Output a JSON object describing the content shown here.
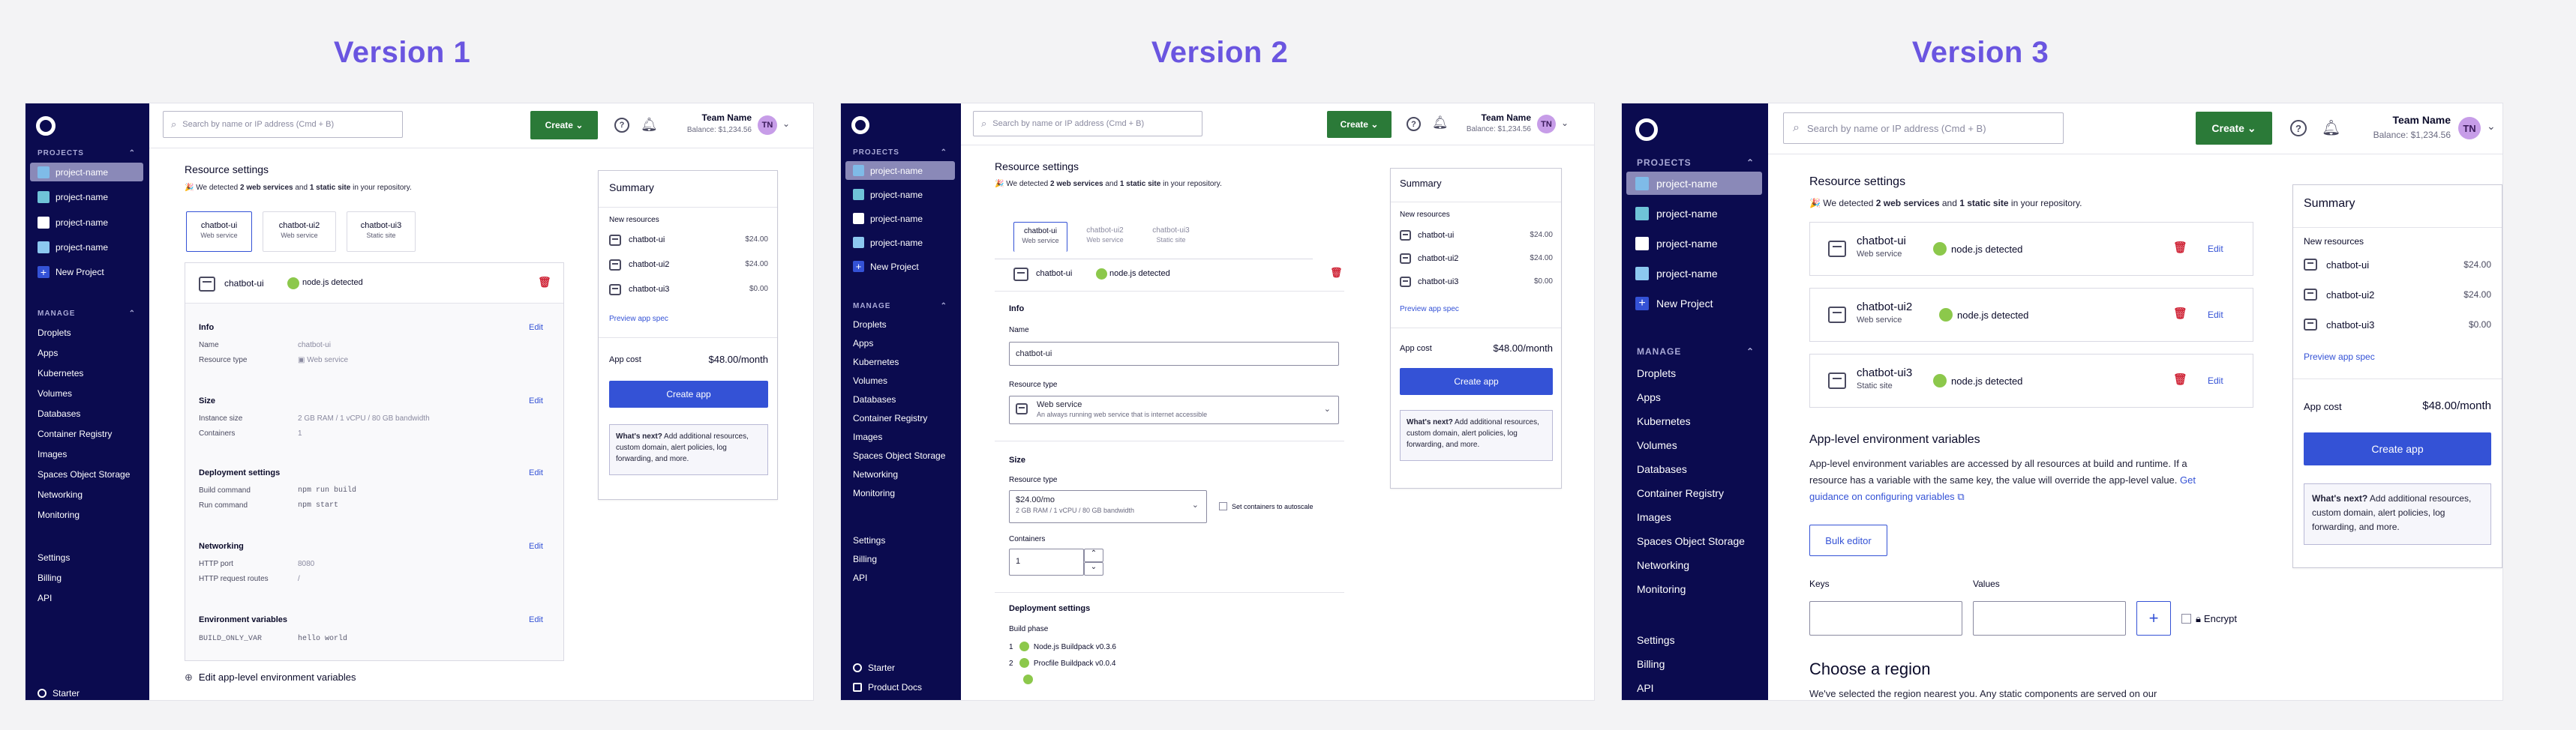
{
  "versions": [
    "Version 1",
    "Version 2",
    "Version 3"
  ],
  "nav": {
    "projects_label": "PROJECTS",
    "projects": [
      "project-name",
      "project-name",
      "project-name",
      "project-name"
    ],
    "new_project": "New Project",
    "manage_label": "MANAGE",
    "manage": [
      "Droplets",
      "Apps",
      "Kubernetes",
      "Volumes",
      "Databases",
      "Container Registry",
      "Images",
      "Spaces Object Storage",
      "Networking",
      "Monitoring"
    ],
    "bottom": [
      "Settings",
      "Billing",
      "API"
    ],
    "starter": "Starter",
    "product_docs": "Product Docs"
  },
  "topbar": {
    "search_placeholder": "Search by name or IP address (Cmd + B)",
    "create": "Create",
    "team_name": "Team Name",
    "balance": "Balance: $1,234.56",
    "avatar": "TN"
  },
  "content": {
    "title": "Resource settings",
    "detected_pre": "We detected ",
    "detected_web": "2 web services",
    "detected_mid": " and ",
    "detected_static": "1 static site",
    "detected_post": " in your repository.",
    "tabs": [
      {
        "name": "chatbot-ui",
        "type": "Web service"
      },
      {
        "name": "chatbot-ui2",
        "type": "Web service"
      },
      {
        "name": "chatbot-ui3",
        "type": "Static site"
      }
    ],
    "node_detected": "node.js detected",
    "selected_component": "chatbot-ui",
    "info": {
      "title": "Info",
      "name_label": "Name",
      "name_value": "chatbot-ui",
      "type_label": "Resource type",
      "type_value": "Web service",
      "type_desc": "An always running web service that is internet accessible"
    },
    "size": {
      "title": "Size",
      "instance_label": "Instance size",
      "instance_value": "2 GB RAM / 1 vCPU / 80 GB bandwidth",
      "containers_label": "Containers",
      "containers_value": "1",
      "price": "$24.00/mo",
      "autoscale": "Set containers to autoscale"
    },
    "deploy": {
      "title": "Deployment settings",
      "build_label": "Build command",
      "build_value": "npm run build",
      "run_label": "Run command",
      "run_value": "npm start",
      "build_phase": "Build phase",
      "buildpacks": [
        "Node.js Buildpack v0.3.6",
        "Procfile Buildpack v0.0.4"
      ]
    },
    "networking": {
      "title": "Networking",
      "port_label": "HTTP port",
      "port_value": "8080",
      "routes_label": "HTTP request routes",
      "routes_value": "/"
    },
    "env": {
      "title": "Environment variables",
      "key": "BUILD_ONLY_VAR",
      "value": "hello world"
    },
    "edit": "Edit",
    "edit_app_env": "Edit app-level environment variables",
    "app_env": {
      "title": "App-level environment variables",
      "desc": "App-level environment variables are accessed by all resources at build and runtime. If a resource has a variable with the same key, the value will override the app-level value.",
      "guidance": "Get guidance on configuring variables",
      "bulk": "Bulk editor",
      "keys": "Keys",
      "values": "Values",
      "encrypt": "Encrypt"
    },
    "region": {
      "title": "Choose a region",
      "desc": "We've selected the region nearest you. Any static components are served on our"
    }
  },
  "summary": {
    "title": "Summary",
    "new_resources": "New resources",
    "items": [
      {
        "name": "chatbot-ui",
        "price": "$24.00"
      },
      {
        "name": "chatbot-ui2",
        "price": "$24.00"
      },
      {
        "name": "chatbot-ui3",
        "price": "$0.00"
      }
    ],
    "preview": "Preview app spec",
    "cost_label": "App cost",
    "cost_value": "$48.00/month",
    "create_app": "Create app",
    "whats_next_bold": "What's next?",
    "whats_next": " Add additional resources, custom domain, alert policies, log forwarding, and more."
  },
  "colors": {
    "accent": "#6a55e0",
    "sidebar": "#0b0b4f",
    "create": "#2b7a38",
    "primary": "#3452d6"
  }
}
